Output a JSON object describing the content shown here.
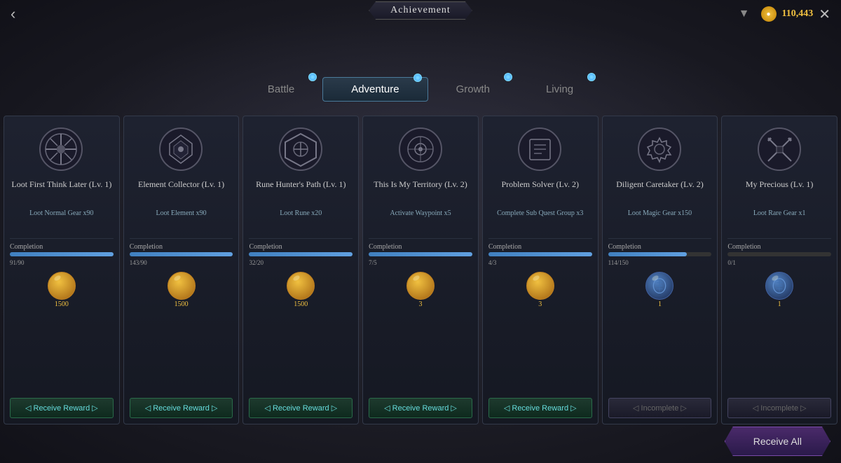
{
  "header": {
    "title": "Achievement",
    "back_label": "‹",
    "close_label": "✕",
    "currency_amount": "110,443",
    "arrow_icon": "▼"
  },
  "tabs": [
    {
      "label": "Battle",
      "active": false,
      "has_indicator": true
    },
    {
      "label": "Adventure",
      "active": true,
      "has_indicator": true
    },
    {
      "label": "Growth",
      "active": false,
      "has_indicator": true
    },
    {
      "label": "Living",
      "active": false,
      "has_indicator": true
    }
  ],
  "cards": [
    {
      "title": "Loot First Think Later (Lv. 1)",
      "desc": "Loot Normal Gear x90",
      "completion_label": "Completion",
      "progress_current": 91,
      "progress_max": 90,
      "progress_text": "91/90",
      "progress_pct": 100,
      "reward_amount": "1500",
      "reward_type": "gold",
      "button_type": "receive",
      "button_label": "Receive Reward"
    },
    {
      "title": "Element Collector (Lv. 1)",
      "desc": "Loot Element x90",
      "completion_label": "Completion",
      "progress_current": 143,
      "progress_max": 90,
      "progress_text": "143/90",
      "progress_pct": 100,
      "reward_amount": "1500",
      "reward_type": "gold",
      "button_type": "receive",
      "button_label": "Receive Reward"
    },
    {
      "title": "Rune Hunter's Path (Lv. 1)",
      "desc": "Loot Rune x20",
      "completion_label": "Completion",
      "progress_current": 32,
      "progress_max": 20,
      "progress_text": "32/20",
      "progress_pct": 100,
      "reward_amount": "1500",
      "reward_type": "gold",
      "button_type": "receive",
      "button_label": "Receive Reward"
    },
    {
      "title": "This Is My Territory (Lv. 2)",
      "desc": "Activate Waypoint x5",
      "completion_label": "Completion",
      "progress_current": 7,
      "progress_max": 5,
      "progress_text": "7/5",
      "progress_pct": 100,
      "reward_amount": "3",
      "reward_type": "blue",
      "button_type": "receive",
      "button_label": "Receive Reward"
    },
    {
      "title": "Problem Solver (Lv. 2)",
      "desc": "Complete Sub Quest Group x3",
      "completion_label": "Completion",
      "progress_current": 4,
      "progress_max": 3,
      "progress_text": "4/3",
      "progress_pct": 100,
      "reward_amount": "3",
      "reward_type": "blue",
      "button_type": "receive",
      "button_label": "Receive Reward"
    },
    {
      "title": "Diligent Caretaker (Lv. 2)",
      "desc": "Loot Magic Gear x150",
      "completion_label": "Completion",
      "progress_current": 114,
      "progress_max": 150,
      "progress_text": "114/150",
      "progress_pct": 76,
      "reward_amount": "1",
      "reward_type": "scroll",
      "button_type": "incomplete",
      "button_label": "Incomplete"
    },
    {
      "title": "My Precious (Lv. 1)",
      "desc": "Loot Rare Gear x1",
      "completion_label": "Completion",
      "progress_current": 0,
      "progress_max": 1,
      "progress_text": "0/1",
      "progress_pct": 0,
      "reward_amount": "1",
      "reward_type": "scroll2",
      "button_type": "incomplete",
      "button_label": "Incomplete"
    }
  ],
  "bottom": {
    "receive_all_label": "Receive All"
  }
}
